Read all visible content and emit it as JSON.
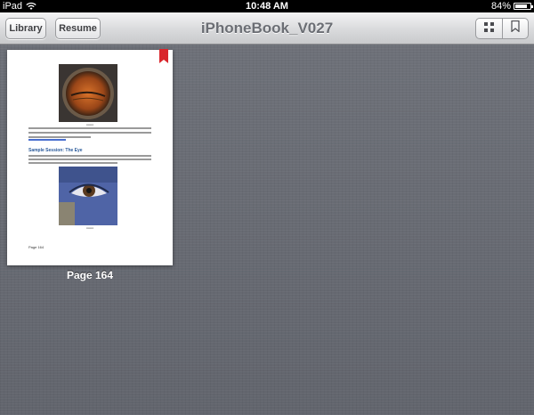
{
  "status_bar": {
    "device": "iPad",
    "time": "10:48 AM",
    "battery": "84%",
    "battery_level": 0.84
  },
  "toolbar": {
    "library_label": "Library",
    "resume_label": "Resume",
    "title": "iPhoneBook_V027",
    "view_modes": [
      "grid-icon",
      "bookmark-icon"
    ]
  },
  "thumbnail": {
    "label": "Page 164",
    "heading": "Sample Session: The Eye",
    "page_footer": "Page 164",
    "bookmark_color": "#d9262c"
  },
  "colors": {
    "background": "#6b6e76",
    "title_text": "#6b6e74"
  }
}
